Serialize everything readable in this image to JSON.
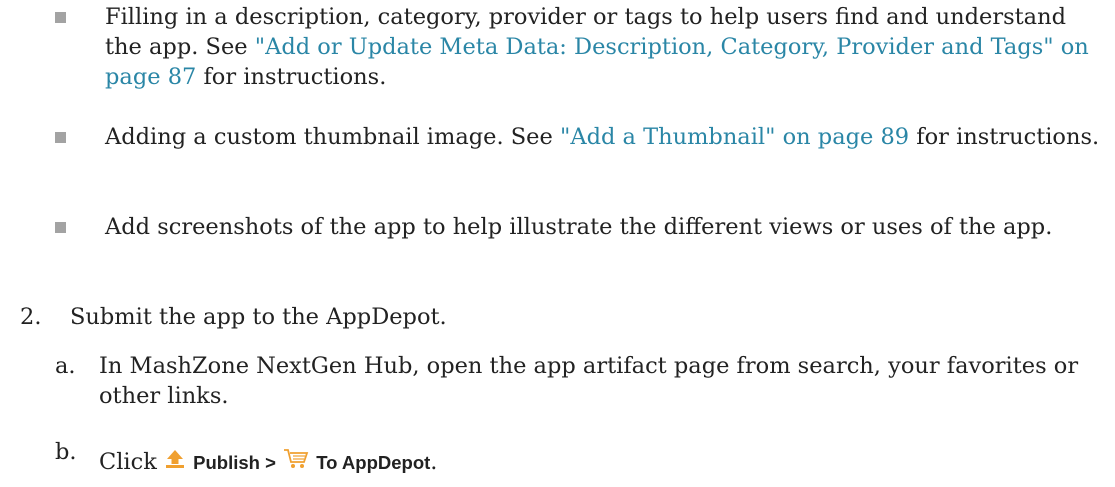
{
  "bullets": [
    {
      "text_before": "Filling in a description, category, provider or tags to help users find and understand the app. See ",
      "link": "\"Add or Update Meta Data: Description, Category, Provider and Tags\" on page 87",
      "text_after": " for instructions."
    },
    {
      "text_before": "Adding a custom thumbnail image. See ",
      "link": "\"Add a Thumbnail\" on page 89",
      "text_after": " for instructions."
    },
    {
      "text": "Add screenshots of the app to help illustrate the different views or uses of the app."
    }
  ],
  "step2": {
    "number": "2.",
    "text": "Submit the app to the AppDepot."
  },
  "substeps": {
    "a": {
      "letter": "a.",
      "text": "In MashZone NextGen Hub, open the app artifact page from search, your favorites or other links."
    },
    "b": {
      "letter": "b.",
      "click": "Click",
      "publish_label": "Publish >",
      "appdepot_label": "To AppDepot",
      "period": ".",
      "publish_icon": "upload-arrow-icon",
      "appdepot_icon": "shopping-cart-icon"
    }
  },
  "colors": {
    "link": "#2a86a6",
    "bullet": "#a3a3a3",
    "icon_orange": "#f0a030"
  }
}
